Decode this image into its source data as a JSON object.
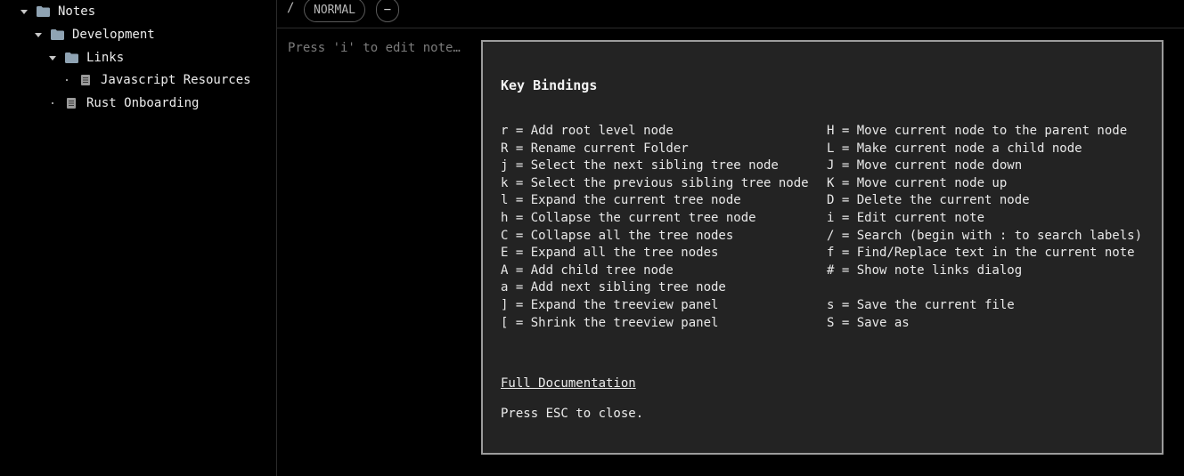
{
  "sidebar": {
    "items": [
      {
        "label": "Notes",
        "kind": "folder",
        "expanded": true,
        "depth": 0
      },
      {
        "label": "Development",
        "kind": "folder",
        "expanded": true,
        "depth": 1
      },
      {
        "label": "Links",
        "kind": "folder",
        "expanded": true,
        "depth": 2
      },
      {
        "label": "Javascript Resources",
        "kind": "note",
        "depth": 3
      },
      {
        "label": "Rust Onboarding",
        "kind": "note",
        "depth": 2
      }
    ]
  },
  "topbar": {
    "path": "/",
    "mode": "NORMAL",
    "minus_label": "−"
  },
  "editor": {
    "placeholder": "Press 'i' to edit note…"
  },
  "modal": {
    "title": "Key Bindings",
    "left_bindings": [
      "r = Add root level node",
      "R = Rename current Folder",
      "j = Select the next sibling tree node",
      "k = Select the previous sibling tree node",
      "l = Expand the current tree node",
      "h = Collapse the current tree node",
      "C = Collapse all the tree nodes",
      "E = Expand all the tree nodes",
      "A = Add child tree node",
      "a = Add next sibling tree node",
      "] = Expand the treeview panel",
      "[ = Shrink the treeview panel"
    ],
    "right_bindings": [
      "H = Move current node to the parent node",
      "L = Make current node a child node",
      "J = Move current node down",
      "K = Move current node up",
      "D = Delete the current node",
      "i = Edit current note",
      "/ = Search (begin with : to search labels)",
      "f = Find/Replace text in the current note",
      "# = Show note links dialog",
      "",
      "s = Save the current file",
      "S = Save as"
    ],
    "docs_link": "Full Documentation",
    "close_hint": "Press ESC to close."
  },
  "colors": {
    "background": "#000000",
    "modal_background": "#232323",
    "modal_border": "#9c9c9c",
    "folder_icon": "#8fa3b3",
    "note_icon": "#9a9a9a"
  },
  "icons": {
    "folder": "folder-icon",
    "note": "note-icon",
    "expand": "caret-down-icon"
  }
}
